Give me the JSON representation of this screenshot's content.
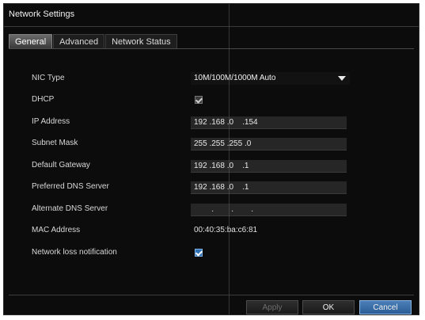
{
  "window": {
    "title": "Network Settings"
  },
  "tabs": [
    {
      "label": "General",
      "active": true
    },
    {
      "label": "Advanced",
      "active": false
    },
    {
      "label": "Network Status",
      "active": false
    }
  ],
  "form": {
    "nic_type": {
      "label": "NIC Type",
      "value": "10M/100M/1000M Auto"
    },
    "dhcp": {
      "label": "DHCP",
      "checked": false
    },
    "ip_address": {
      "label": "IP Address",
      "value": "192 .168 .0    .154"
    },
    "subnet_mask": {
      "label": "Subnet Mask",
      "value": "255 .255 .255 .0"
    },
    "default_gateway": {
      "label": "Default Gateway",
      "value": "192 .168 .0    .1"
    },
    "preferred_dns": {
      "label": "Preferred DNS Server",
      "value": "192 .168 .0    .1"
    },
    "alternate_dns": {
      "label": "Alternate DNS Server",
      "value": "        .        .        ."
    },
    "mac_address": {
      "label": "MAC Address",
      "value": "00:40:35:ba:c6:81"
    },
    "network_loss": {
      "label": "Network loss notification",
      "checked": true
    }
  },
  "buttons": {
    "apply": "Apply",
    "ok": "OK",
    "cancel": "Cancel"
  },
  "colors": {
    "background": "#0c0c0c",
    "accent": "#2d6fb3",
    "text": "#e6e6e6"
  }
}
